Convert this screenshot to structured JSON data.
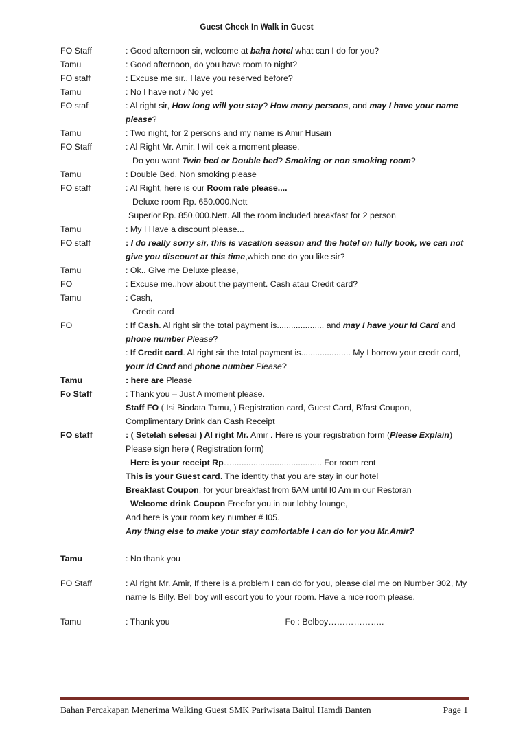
{
  "document": {
    "title": "Guest Check In Walk in Guest",
    "speakers": {
      "fo_staff_cap": "FO Staff",
      "fo_staff_low": "FO staff",
      "fo_staf": "FO staf",
      "fo": "FO",
      "fo_staff_mixed": "Fo Staff",
      "tamu": "Tamu"
    },
    "lines": [
      {
        "speaker": "FO Staff",
        "text": ":  Good afternoon sir, welcome at baha hotel  what can I do for you?"
      },
      {
        "speaker": "Tamu",
        "text": ": Good afternoon, do you have room to night?"
      },
      {
        "speaker": "FO staff",
        "text": ": Excuse me sir.. Have you reserved before?"
      },
      {
        "speaker": "Tamu",
        "text": ": No I have not / No yet"
      },
      {
        "speaker": "FO staf",
        "text": ": Al right sir, How long will you stay? How many persons, and may I have your name please?"
      },
      {
        "speaker": "Tamu",
        "text": ": Two night, for 2 persons and my name is  Amir Husain"
      },
      {
        "speaker": "FO Staff",
        "text": ": Al Right Mr. Amir, I will cek a moment please,"
      },
      {
        "speaker": "",
        "text": "Do you want  Twin bed or Double bed? Smoking or non smoking room?"
      },
      {
        "speaker": "Tamu",
        "text": ": Double Bed, Non smoking please"
      },
      {
        "speaker": "FO staff",
        "text": ": Al Right, here is our Room rate please...."
      },
      {
        "speaker": "",
        "text": "Deluxe room   Rp. 650.000.Nett"
      },
      {
        "speaker": "",
        "text": "Superior Rp. 850.000.Nett.  All the room included breakfast for 2 person"
      },
      {
        "speaker": "Tamu",
        "text": ": My I Have a discount please..."
      },
      {
        "speaker": "FO staff",
        "text": ": I do really sorry sir, this is vacation season and the hotel on fully book, we can not give you discount at this time,which one do you like sir?"
      },
      {
        "speaker": "Tamu",
        "text": ": Ok.. Give me Deluxe please,"
      },
      {
        "speaker": "FO",
        "text": ": Excuse me..how about the payment.  Cash atau Credit card?"
      },
      {
        "speaker": "Tamu",
        "text": ":  Cash,"
      },
      {
        "speaker": "",
        "text": "Credit card"
      },
      {
        "speaker": "FO",
        "text": ":  If Cash. Al right sir the total payment is.................... and may I have your Id Card and phone number Please?"
      },
      {
        "speaker": "",
        "text": ":  If Credit card. Al right sir the total payment is..................... My I borrow your credit card, your Id Card and phone number Please?"
      },
      {
        "speaker": "Tamu",
        "text": ": here are Please"
      },
      {
        "speaker": "Fo Staff",
        "text": ": Thank you – Just A moment please."
      },
      {
        "speaker": "",
        "text": "Staff FO  ( Isi Biodata Tamu, ) Registration card, Guest Card, B'fast Coupon, Complimentary Drink  dan Cash Receipt"
      },
      {
        "speaker": "FO staff",
        "text": ": ( Setelah selesai ) Al right Mr. Amir . Here is your registration form (Please Explain)"
      },
      {
        "speaker": "",
        "text": "Please sign here ( Registration form)"
      },
      {
        "speaker": "",
        "text": "Here is your receipt Rp…...................................... For room rent"
      },
      {
        "speaker": "",
        "text": "This is your Guest card. The identity that you are stay in our hotel"
      },
      {
        "speaker": "",
        "text": "Breakfast Coupon, for your breakfast from 6AM until I0 Am in our Restoran"
      },
      {
        "speaker": "",
        "text": "Welcome drink Coupon Freefor you in our lobby lounge,"
      },
      {
        "speaker": "",
        "text": "And here is your room key number # I05."
      },
      {
        "speaker": "",
        "text": "Any thing else to make your stay comfortable I can do for you Mr.Amir?"
      },
      {
        "speaker": "Tamu",
        "text": ": No thank you"
      },
      {
        "speaker": "FO Staff",
        "text": ":  Al right Mr. Amir, If there is a problem I can do for you, please dial me on Number 302, My name Is Billy. Bell boy will escort you to your room. Have a nice room please."
      },
      {
        "speaker": "Tamu",
        "text": ": Thank you"
      }
    ],
    "segments": {
      "l1_a": ":  Good afternoon sir, welcome at ",
      "l1_b": "baha hotel",
      "l1_c": " what can I do for you?",
      "l2": ": Good afternoon, do you have room to night?",
      "l3": ": Excuse me sir.. Have you reserved before?",
      "l4": ": No I have not / No yet",
      "l5_a": ": Al right sir, ",
      "l5_b": "How long will you stay",
      "l5_c": "? ",
      "l5_d": "How many persons",
      "l5_e": ", and ",
      "l5_f": "may I have your name please",
      "l5_g": "?",
      "l6": ": Two night, for 2 persons and my name is  Amir Husain",
      "l7": ": Al Right Mr. Amir, I will cek a moment please,",
      "l8_a": "Do you want  ",
      "l8_b": "Twin bed or Double bed",
      "l8_c": "? ",
      "l8_d": "Smoking or non smoking room",
      "l8_e": "?",
      "l9": ": Double Bed, Non smoking please",
      "l10_a": ": Al Right, here is our ",
      "l10_b": "Room rate please",
      "l10_c": "....",
      "l11": "Deluxe room   Rp. 650.000.Nett",
      "l12": "Superior Rp. 850.000.Nett.  All the room included breakfast for 2 person",
      "l13": ": My I Have a discount please...",
      "l14_a": ": ",
      "l14_b": "I do really sorry sir, this is vacation season and the hotel on fully book, we can not give you discount at this time",
      "l14_c": ",which one do you like sir?",
      "l15": ": Ok.. Give me Deluxe please,",
      "l16": ": Excuse me..how about the payment.  Cash atau Credit card?",
      "l17": ":  Cash,",
      "l18": "Credit card",
      "l19_a": ":  ",
      "l19_b": "If Cash",
      "l19_c": ". Al right sir the total payment is.................... and ",
      "l19_d": "may I have your Id Card",
      "l19_e": " and ",
      "l19_f": "phone number",
      "l19_g": " Please",
      "l19_h": "?",
      "l20_a": ":  ",
      "l20_b": "If Credit card",
      "l20_c": ". Al right sir the total payment is..................... My I borrow your credit card, ",
      "l20_d": "your Id Card",
      "l20_e": " and ",
      "l20_f": "phone number",
      "l20_g": " Please",
      "l20_h": "?",
      "l21_a": ": here are",
      "l21_b": " Please",
      "l22": ": Thank you – Just A moment please.",
      "l23_a": "Staff FO",
      "l23_b": "  ( Isi Biodata Tamu, ) Registration card, Guest Card, B'fast Coupon,",
      "l24": "Complimentary Drink  dan Cash Receipt",
      "l25_a": ": ( Setelah selesai ) Al right Mr.",
      "l25_b": " Amir . Here is your registration form (",
      "l25_c": "Please Explain",
      "l25_d": ")",
      "l26": "Please sign here ( Registration form)",
      "l27_a": "Here is your receipt Rp",
      "l27_b": "…...................................... For room rent",
      "l28_a": "This is your Guest card",
      "l28_b": ". The identity that you are stay in our hotel",
      "l29_a": "Breakfast Coupon",
      "l29_b": ", for your breakfast from 6AM until I0 Am in our Restoran",
      "l30_a": "Welcome drink Coupon",
      "l30_b": " Freefor you in our lobby lounge,",
      "l31": "And here is your room key number # I05.",
      "l32": "Any thing else to make your stay comfortable I can do for you Mr.Amir?",
      "l33": ": No thank you",
      "l34": ":  Al right Mr. Amir, If there is a problem I can do for you, please dial me on Number 302, My name Is Billy. Bell boy will escort you to your room. Have a nice room please.",
      "l35": ": Thank you",
      "l35_note": "Fo : Belboy……………….."
    }
  },
  "footer": {
    "text": "Bahan Percakapan Menerima Walking Guest SMK Pariwisata Baitul Hamdi Banten",
    "page": "Page 1",
    "rule_color": "#7b2d26"
  }
}
